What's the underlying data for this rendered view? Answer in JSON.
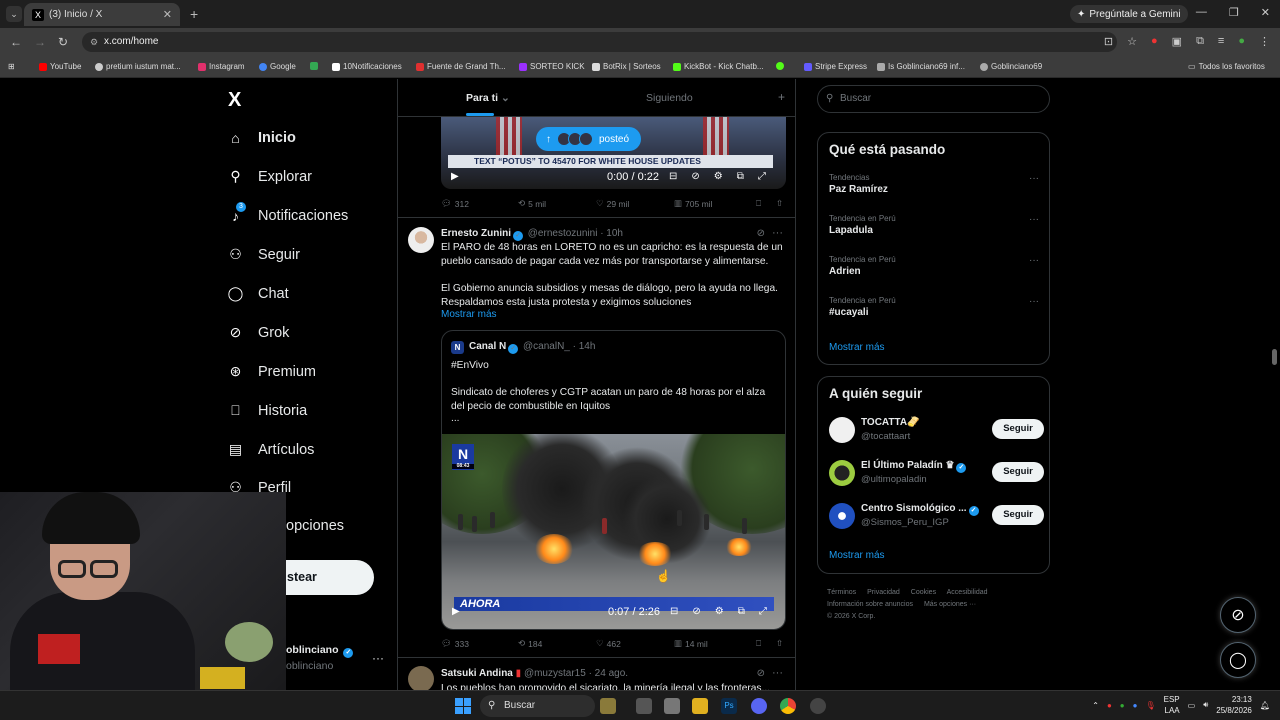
{
  "browser": {
    "tab_title": "(3) Inicio / X",
    "tab_favicon": "X",
    "gemini_label": "Pregúntale a Gemini",
    "url": "x.com/home",
    "bookmarks": [
      {
        "label": "YouTube",
        "color": "#ff0000"
      },
      {
        "label": "pretium iustum mat...",
        "color": "#cccccc"
      },
      {
        "label": "Instagram",
        "color": "#e1306c"
      },
      {
        "label": "Google",
        "color": "#4285f4"
      },
      {
        "label": "",
        "color": "#34a853"
      },
      {
        "label": "10Notificaciones",
        "color": "#ffffff"
      },
      {
        "label": "Fuente de Grand Th...",
        "color": "#e03030"
      },
      {
        "label": "SORTEO KICK",
        "color": "#9b30ff"
      },
      {
        "label": "BotRix | Sorteos",
        "color": "#dddddd"
      },
      {
        "label": "KickBot - Kick Chatb...",
        "color": "#53fc18"
      },
      {
        "label": "",
        "color": "#53fc18"
      },
      {
        "label": "Stripe Express",
        "color": "#635bff"
      },
      {
        "label": "Is Goblinciano69 inf...",
        "color": "#aaaaaa"
      },
      {
        "label": "Goblinciano69",
        "color": "#aaaaaa"
      }
    ],
    "all_favorites": "Todos los favoritos"
  },
  "sidebar": {
    "logo": "X",
    "items": [
      {
        "label": "Inicio",
        "icon": "home-icon",
        "glyph": "⌂"
      },
      {
        "label": "Explorar",
        "icon": "search-icon",
        "glyph": "⚲"
      },
      {
        "label": "Notificaciones",
        "icon": "bell-icon",
        "glyph": "🔔"
      },
      {
        "label": "Seguir",
        "icon": "follow-icon",
        "glyph": "👤"
      },
      {
        "label": "Chat",
        "icon": "chat-icon",
        "glyph": "◯"
      },
      {
        "label": "Grok",
        "icon": "grok-icon",
        "glyph": "⊘"
      },
      {
        "label": "Premium",
        "icon": "premium-icon",
        "glyph": "✔"
      },
      {
        "label": "Historia",
        "icon": "bookmark-icon",
        "glyph": "▯"
      },
      {
        "label": "Artículos",
        "icon": "articles-icon",
        "glyph": "▤"
      },
      {
        "label": "Perfil",
        "icon": "profile-icon",
        "glyph": "👤"
      },
      {
        "label": "opciones",
        "icon": "more-icon",
        "glyph": "⋯"
      }
    ],
    "notif_badge": "3",
    "post_button": "stear",
    "account_name": "oblinciano",
    "account_handle": "oblinciano"
  },
  "feed": {
    "tabs": {
      "for_you": "Para ti",
      "following": "Siguiendo"
    },
    "posted_pill": "posteó",
    "video1": {
      "banner": "TEXT “POTUS” TO 45470 FOR WHITE HOUSE UPDATES",
      "time": "0:00 / 0:22"
    },
    "actions1": {
      "replies": "312",
      "reposts": "5 mil",
      "likes": "29 mil",
      "views": "705 mil"
    },
    "tweet2": {
      "name": "Ernesto Zunini",
      "handle": "@ernestozunini · 10h",
      "text1": "El PARO de 48 horas en LORETO no es un capricho: es la respuesta de un pueblo cansado de pagar cada vez más por transportarse y alimentarse.",
      "text2": "El Gobierno anuncia subsidios y mesas de diálogo, pero la ayuda no llega. Respaldamos esta justa protesta y exigimos soluciones",
      "show_more": "Mostrar más",
      "quote": {
        "name": "Canal N",
        "handle": "@canalN_ · 14h",
        "hashtag": "#EnVivo",
        "text": "Sindicato de choferes y CGTP acatan un paro de 48 horas por el alza del pecio de combustible en Iquitos",
        "ellipsis": "...",
        "logo_time": "08:43",
        "ahora": "AHORA",
        "video_time": "0:07 / 2:26"
      },
      "actions": {
        "replies": "333",
        "reposts": "184",
        "likes": "462",
        "views": "14 mil"
      }
    },
    "tweet3": {
      "name": "Satsuki Andina",
      "handle": "@muzystar15 · 24 ago.",
      "text": "Los pueblos han promovido el sicariato, la minería ilegal y las fronteras..."
    }
  },
  "right": {
    "search_placeholder": "Buscar",
    "trends_title": "Qué está pasando",
    "trends": [
      {
        "context": "Tendencias",
        "name": "Paz Ramírez"
      },
      {
        "context": "Tendencia en Perú",
        "name": "Lapadula"
      },
      {
        "context": "Tendencia en Perú",
        "name": "Adrien"
      },
      {
        "context": "Tendencia en Perú",
        "name": "#ucayali"
      }
    ],
    "show_more": "Mostrar más",
    "follow_title": "A quién seguir",
    "follow": [
      {
        "name": "TOCATTA🫔",
        "handle": "@tocattaart",
        "button": "Seguir",
        "color": "#f0f0f0"
      },
      {
        "name": "El Último Paladín ♛",
        "handle": "@ultimopaladin",
        "button": "Seguir",
        "color": "#9ccc40"
      },
      {
        "name": "Centro Sismológico ...",
        "handle": "@Sismos_Peru_IGP",
        "button": "Seguir",
        "color": "#2050c0"
      }
    ],
    "footer": [
      "Términos",
      "Privacidad",
      "Cookies",
      "Accesibilidad",
      "Información sobre anuncios",
      "Más opciones ···",
      "© 2026 X Corp."
    ]
  },
  "taskbar": {
    "search": "Buscar",
    "lang": "ESP",
    "lang2": "LAA",
    "time": "23:13",
    "date": "25/8/2026"
  },
  "colors": {
    "accent": "#1d9bf0",
    "border": "#2f3336",
    "muted": "#71767b"
  }
}
